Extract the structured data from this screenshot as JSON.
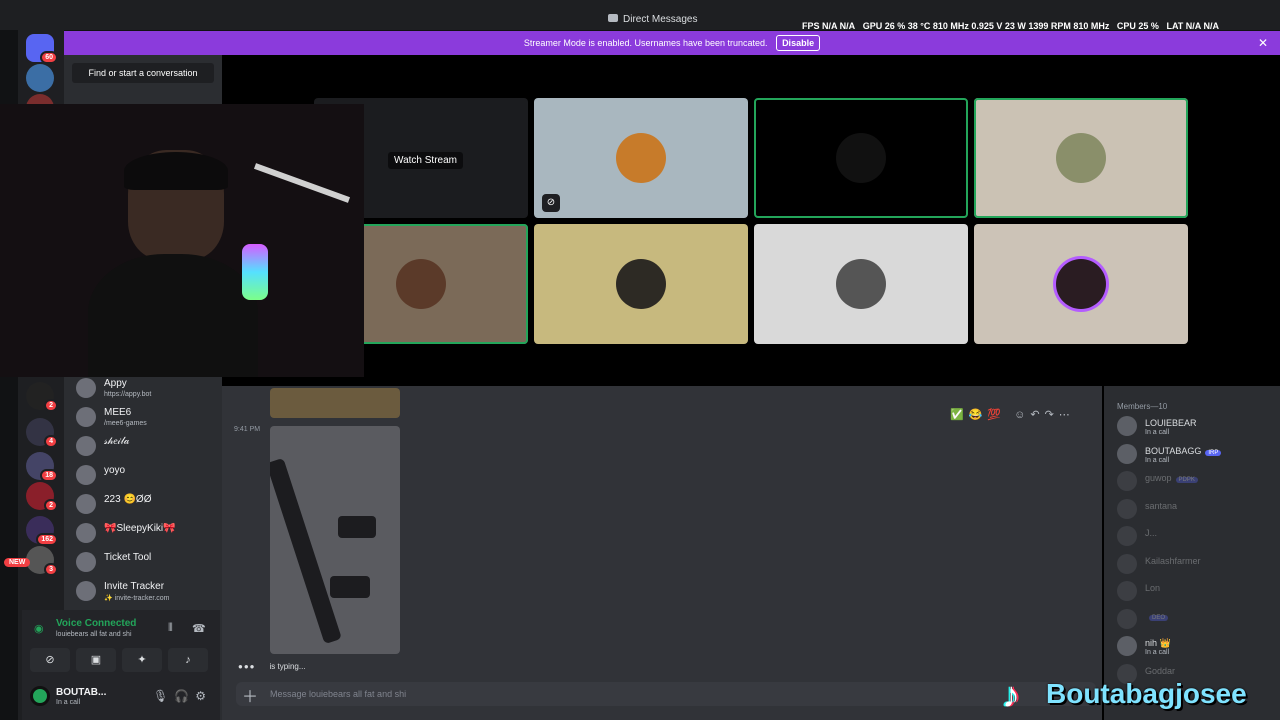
{
  "window": {
    "title": "Direct Messages",
    "controls": [
      "—",
      "□",
      "✕"
    ]
  },
  "perf_overlay": {
    "fps": "FPS  N/A  N/A",
    "gpu": "GPU 26 %  38 °C  810 MHz  0.925 V  23 W  1399 RPM  810 MHz",
    "cpu": "CPU 25 %",
    "lat": "LAT  N/A  N/A"
  },
  "banner": {
    "text": "Streamer Mode is enabled. Usernames have been truncated.",
    "button": "Disable",
    "close": "✕"
  },
  "servers": [
    {
      "badge": "60"
    },
    {
      "badge": ""
    },
    {
      "badge": ""
    },
    {
      "badge": "2"
    },
    {
      "badge": "4"
    },
    {
      "badge": "18"
    },
    {
      "badge": "2"
    },
    {
      "badge": "162"
    },
    {
      "badge": "3"
    }
  ],
  "new_badge": "NEW",
  "sidebar": {
    "finder": "Find or start a conversation",
    "dms": [
      {
        "name": "Appy",
        "sub": "https://appy.bot"
      },
      {
        "name": "MEE6",
        "sub": "/mee6-games"
      },
      {
        "name": "𝓈𝒽𝑒𝒾𝓁𝒶",
        "sub": ""
      },
      {
        "name": "yoyo",
        "sub": ""
      },
      {
        "name": "223 😊ØØ",
        "sub": ""
      },
      {
        "name": "🎀SleepyKiki🎀",
        "sub": ""
      },
      {
        "name": "Ticket Tool",
        "sub": ""
      },
      {
        "name": "Invite Tracker",
        "sub": "✨ invite-tracker.com"
      }
    ]
  },
  "voice": {
    "status": "Voice Connected",
    "channel": "louiebears all fat and shi",
    "user": "BOUTAB...",
    "user_status": "In a call"
  },
  "stage": {
    "watch_stream": "Watch Stream",
    "tiles": [
      {
        "bg": "#1b1c1f",
        "speaking": false,
        "av": ""
      },
      {
        "bg": "#a9b7bf",
        "speaking": false,
        "av": "#c77b2a"
      },
      {
        "bg": "#000000",
        "speaking": true,
        "av": "#111111"
      },
      {
        "bg": "#cbc2b4",
        "speaking": true,
        "av": "#8a8f6a"
      },
      {
        "bg": "#7b6a58",
        "speaking": true,
        "av": "#5b3a29"
      },
      {
        "bg": "#c7b97e",
        "speaking": false,
        "av": "#2d2a24"
      },
      {
        "bg": "#d9d9d9",
        "speaking": false,
        "av": "#555555"
      },
      {
        "bg": "#ccc3b7",
        "speaking": false,
        "av": "#2a1c22"
      }
    ]
  },
  "chat": {
    "time": "9:41 PM",
    "toolbar": "✅😂💯 ☺↶↷⋯",
    "typing_dots": "●●●",
    "typing": "is typing...",
    "placeholder": "Message louiebears all fat and shi"
  },
  "members": {
    "header": "Members—10",
    "list": [
      {
        "name": "LOUIEBEAR",
        "status": "In a call",
        "tag": "",
        "dim": false
      },
      {
        "name": "BOUTABAGG",
        "status": "In a call",
        "tag": "IRP",
        "dim": false
      },
      {
        "name": "guwop",
        "status": "",
        "tag": "PDPK",
        "dim": true
      },
      {
        "name": "santana",
        "status": "",
        "tag": "",
        "dim": true
      },
      {
        "name": "J...",
        "status": "",
        "tag": "",
        "dim": true
      },
      {
        "name": "Kailashfarmer",
        "status": "",
        "tag": "",
        "dim": true
      },
      {
        "name": "Lon",
        "status": "",
        "tag": "",
        "dim": true
      },
      {
        "name": "",
        "status": "",
        "tag": "DEO",
        "dim": true
      },
      {
        "name": "nih 👑",
        "status": "In a call",
        "tag": "",
        "dim": false
      },
      {
        "name": "Goddar",
        "status": "",
        "tag": "",
        "dim": true
      }
    ]
  },
  "watermark": {
    "name": "Boutabagjosee"
  }
}
